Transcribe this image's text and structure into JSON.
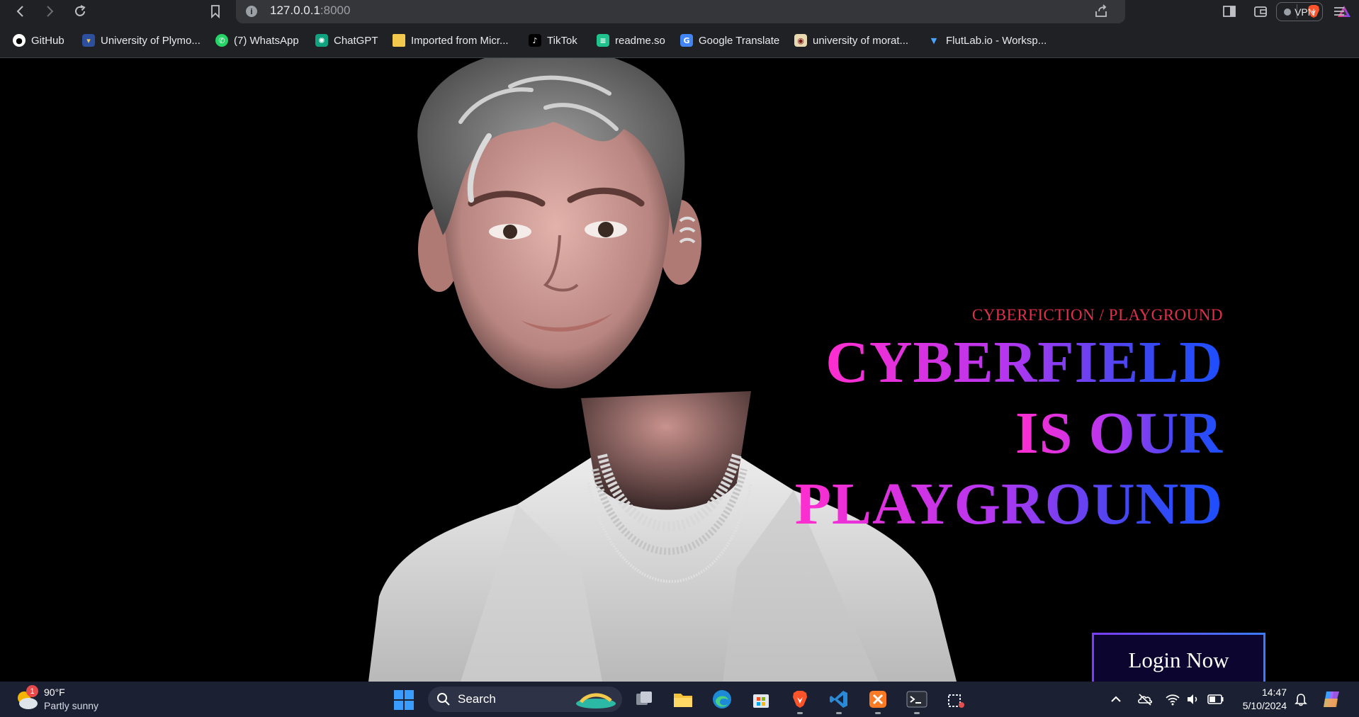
{
  "browser": {
    "url_host": "127.0.0.1",
    "url_port": ":8000",
    "vpn_label": "VPN"
  },
  "bookmarks": [
    {
      "label": "GitHub",
      "icon": "github-icon"
    },
    {
      "label": "University of Plymo...",
      "icon": "university-crest-icon"
    },
    {
      "label": "(7) WhatsApp",
      "icon": "whatsapp-icon"
    },
    {
      "label": "ChatGPT",
      "icon": "chatgpt-icon"
    },
    {
      "label": "Imported from Micr...",
      "icon": "folder-icon"
    },
    {
      "label": "TikTok",
      "icon": "tiktok-icon"
    },
    {
      "label": "readme.so",
      "icon": "readme-icon"
    },
    {
      "label": "Google Translate",
      "icon": "google-translate-icon"
    },
    {
      "label": "university of morat...",
      "icon": "university-moratuwa-icon"
    },
    {
      "label": "FlutLab.io - Worksp...",
      "icon": "flutlab-icon"
    }
  ],
  "hero": {
    "subtitle": "CYBERFICTION / PLAYGROUND",
    "headline_1": "CYBERFIELD",
    "headline_2": "IS OUR",
    "headline_3": "PLAYGROUND",
    "login_label": "Login Now"
  },
  "taskbar": {
    "weather_temp": "90°F",
    "weather_desc": "Partly sunny",
    "weather_badge": "1",
    "search_label": "Search",
    "time": "14:47",
    "date": "5/10/2024"
  },
  "colors": {
    "accent_gradient_start": "#ff2ecf",
    "accent_gradient_end": "#1d4fff",
    "subtitle_red": "#e0304a",
    "page_background": "#000000"
  }
}
